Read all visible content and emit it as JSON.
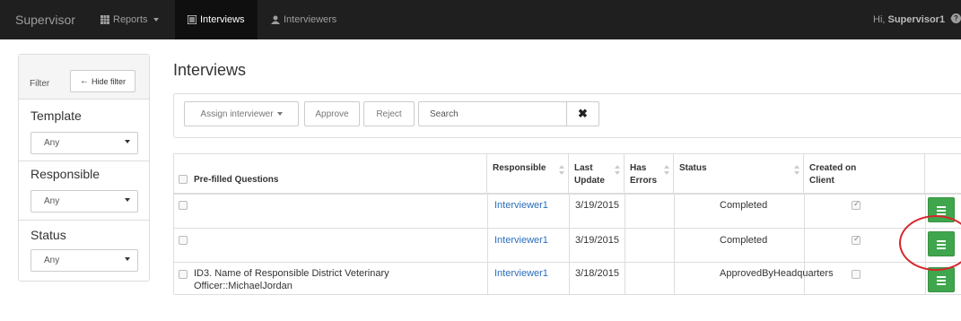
{
  "navbar": {
    "brand": "Supervisor",
    "reports": "Reports",
    "interviews": "Interviews",
    "interviewers": "Interviewers",
    "greeting": "Hi, ",
    "username": "Supervisor1"
  },
  "filter": {
    "label": "Filter",
    "hide_button": "Hide filter",
    "template_title": "Template",
    "template_value": "Any",
    "responsible_title": "Responsible",
    "responsible_value": "Any",
    "status_title": "Status",
    "status_value": "Any"
  },
  "page": {
    "title": "Interviews"
  },
  "toolbar": {
    "assign": "Assign interviewer",
    "approve": "Approve",
    "reject": "Reject",
    "search_placeholder": "Search",
    "clear": "✖"
  },
  "table": {
    "headers": {
      "prefilled": "Pre-filled Questions",
      "responsible": "Responsible",
      "last_update_1": "Last",
      "last_update_2": "Update",
      "has_errors_1": "Has",
      "has_errors_2": "Errors",
      "status": "Status",
      "created_1": "Created on",
      "created_2": "Client"
    },
    "rows": [
      {
        "prefilled_1": "",
        "prefilled_2": "",
        "responsible": "Interviewer1",
        "last_update": "3/19/2015",
        "has_errors": "",
        "status": "Completed",
        "created_on_client": true
      },
      {
        "prefilled_1": "",
        "prefilled_2": "",
        "responsible": "Interviewer1",
        "last_update": "3/19/2015",
        "has_errors": "",
        "status": "Completed",
        "created_on_client": true
      },
      {
        "prefilled_1": "ID3. Name of Responsible District Veterinary",
        "prefilled_2": "Officer::MichaelJordan",
        "responsible": "Interviewer1",
        "last_update": "3/18/2015",
        "has_errors": "",
        "status": "ApprovedByHeadquarters",
        "created_on_client": false
      }
    ]
  },
  "colors": {
    "navbar": "#1f1f1f",
    "link": "#2a6ebb",
    "action_button": "#3fa64d",
    "highlight_circle": "#d8262c"
  }
}
